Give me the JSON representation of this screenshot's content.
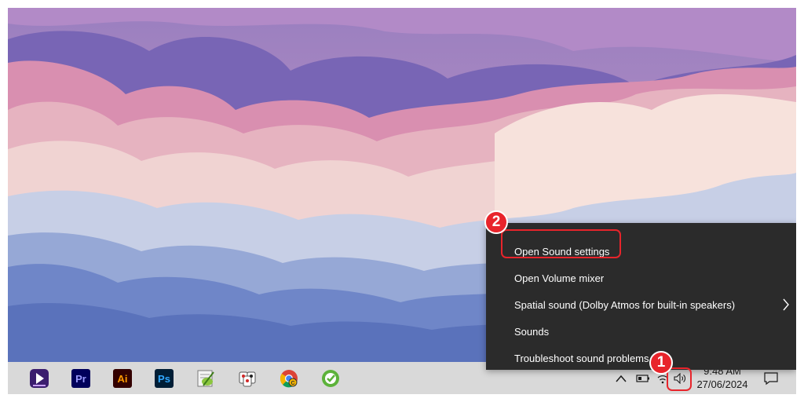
{
  "taskbar": {
    "apps": [
      {
        "name": "stream-app",
        "icon": "play-icon"
      },
      {
        "name": "premiere-pro",
        "label": "Pr",
        "bg": "#00005b",
        "fg": "#9999ff"
      },
      {
        "name": "illustrator",
        "label": "Ai",
        "bg": "#330000",
        "fg": "#ff9a00"
      },
      {
        "name": "photoshop",
        "label": "Ps",
        "bg": "#001e36",
        "fg": "#31a8ff"
      },
      {
        "name": "notepad-plus-plus",
        "icon": "notepad-icon"
      },
      {
        "name": "cards-app",
        "icon": "cards-icon"
      },
      {
        "name": "chrome",
        "icon": "chrome-icon"
      },
      {
        "name": "green-app",
        "icon": "check-circle-icon"
      }
    ],
    "tray": {
      "time": "9:48 AM",
      "date": "27/06/2024"
    }
  },
  "context_menu": {
    "items": [
      {
        "label": "Open Sound settings"
      },
      {
        "label": "Open Volume mixer"
      },
      {
        "label": "Spatial sound (Dolby Atmos for built-in speakers)",
        "has_submenu": true
      },
      {
        "label": "Sounds"
      },
      {
        "label": "Troubleshoot sound problems"
      }
    ]
  },
  "annotations": {
    "step1": "1",
    "step2": "2",
    "color": "#e8242b"
  }
}
